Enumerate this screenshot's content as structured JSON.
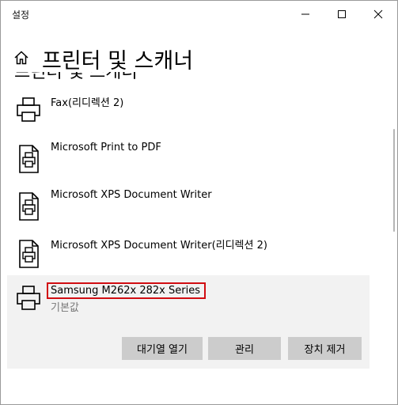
{
  "window": {
    "title": "설정",
    "controls": {
      "minimize": "minimize-icon",
      "maximize": "maximize-icon",
      "close": "close-icon"
    }
  },
  "header": {
    "home_icon": "home-icon",
    "title": "프린터 및 스캐너",
    "cut_heading": "프린터 및 스캐너"
  },
  "printers": [
    {
      "name": "Fax(리디렉션 2)",
      "icon": "printer-icon"
    },
    {
      "name": "Microsoft Print to PDF",
      "icon": "document-printer-icon"
    },
    {
      "name": "Microsoft XPS Document Writer",
      "icon": "document-printer-icon"
    },
    {
      "name": "Microsoft XPS Document Writer(리디렉션 2)",
      "icon": "document-printer-icon"
    }
  ],
  "selected_printer": {
    "name": "Samsung M262x 282x Series",
    "status": "기본값",
    "icon": "printer-icon",
    "buttons": {
      "open_queue": "대기열 열기",
      "manage": "관리",
      "remove": "장치 제거"
    }
  },
  "colors": {
    "highlight": "#d10d12",
    "selected_bg": "#f2f2f2",
    "button_bg": "#cccccc"
  }
}
